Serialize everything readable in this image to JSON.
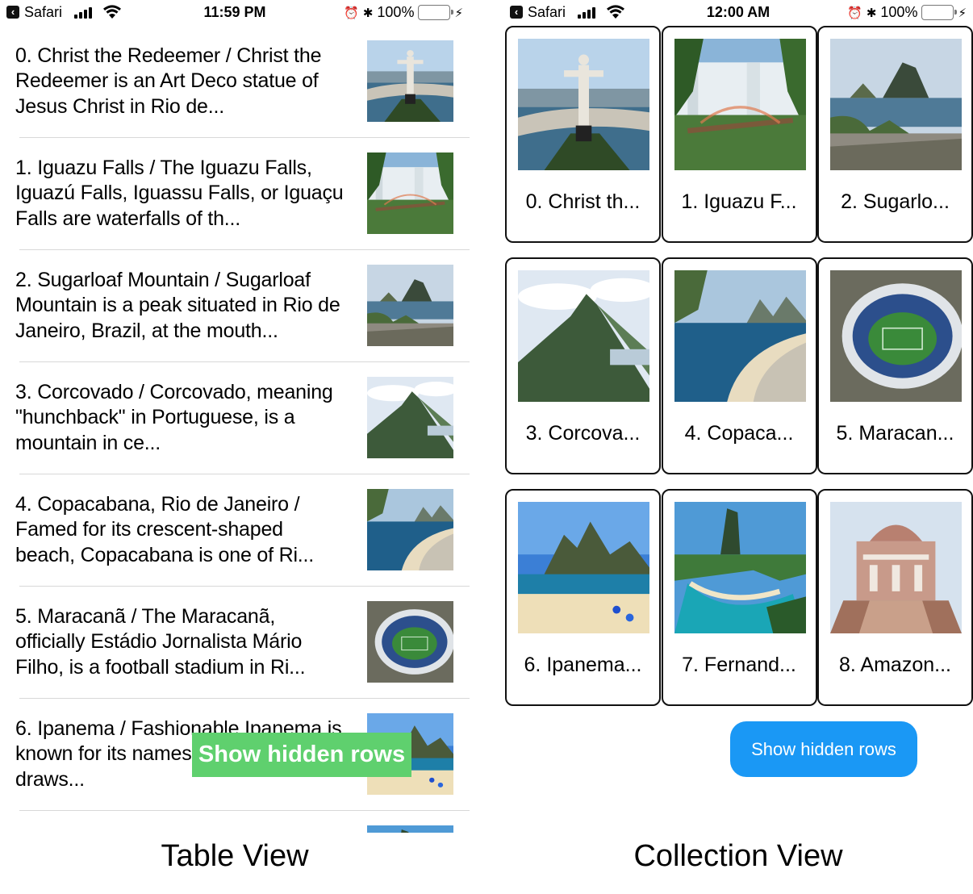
{
  "left_phone": {
    "status": {
      "carrier": "Safari",
      "time": "11:59 PM",
      "battery": "100%"
    },
    "rows": [
      {
        "text": "0. Christ the Redeemer / Christ the Redeemer is an Art Deco statue of Jesus Christ in Rio de...",
        "thumb": "christ"
      },
      {
        "text": "1. Iguazu Falls / The Iguazu Falls, Iguazú Falls, Iguassu Falls, or Iguaçu Falls are waterfalls of th...",
        "thumb": "iguazu"
      },
      {
        "text": "2. Sugarloaf Mountain / Sugarloaf Mountain is a peak situated in Rio de Janeiro, Brazil, at the mouth...",
        "thumb": "sugarloaf"
      },
      {
        "text": "3. Corcovado / Corcovado, meaning \"hunchback\" in Portuguese, is a mountain in ce...",
        "thumb": "corcovado"
      },
      {
        "text": "4. Copacabana, Rio de Janeiro / Famed for its crescent-shaped beach, Copacabana is one of Ri...",
        "thumb": "copacabana"
      },
      {
        "text": "5. Maracanã / The Maracanã, officially Estádio Jornalista Mário Filho, is a football stadium in Ri...",
        "thumb": "maracana"
      },
      {
        "text": "6. Ipanema / Fashionable Ipanema is known for its namesake beach, which draws...",
        "thumb": "ipanema"
      },
      {
        "text": "",
        "thumb": "fernando"
      }
    ],
    "button_label": "Show hidden rows"
  },
  "right_phone": {
    "status": {
      "carrier": "Safari",
      "time": "12:00 AM",
      "battery": "100%"
    },
    "cells": [
      {
        "label": "0. Christ th...",
        "thumb": "christ"
      },
      {
        "label": "1. Iguazu F...",
        "thumb": "iguazu"
      },
      {
        "label": "2. Sugarlo...",
        "thumb": "sugarloaf"
      },
      {
        "label": "3. Corcova...",
        "thumb": "corcovado"
      },
      {
        "label": "4. Copaca...",
        "thumb": "copacabana"
      },
      {
        "label": "5. Maracan...",
        "thumb": "maracana"
      },
      {
        "label": "6. Ipanema...",
        "thumb": "ipanema"
      },
      {
        "label": "7. Fernand...",
        "thumb": "fernando"
      },
      {
        "label": "8. Amazon...",
        "thumb": "amazon"
      }
    ],
    "button_label": "Show hidden rows"
  },
  "captions": {
    "left": "Table View",
    "right": "Collection View"
  },
  "colors": {
    "green_button": "#5fd06e",
    "blue_button": "#1a98f5",
    "battery": "#4cd964",
    "cell_border": "#111111"
  }
}
